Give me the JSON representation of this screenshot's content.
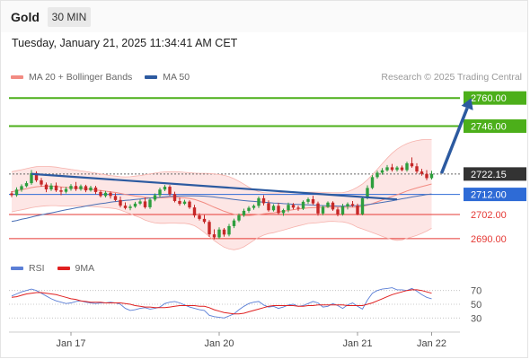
{
  "header": {
    "title": "Gold",
    "timeframe": "30 MIN"
  },
  "datetime": "Tuesday, January 21, 2025 11:34:41 AM CET",
  "credit": "Research © 2025 Trading Central",
  "legend_main": [
    {
      "label": "MA 20 + Bollinger Bands",
      "color": "#f28b82"
    },
    {
      "label": "MA 50",
      "color": "#2c5aa0"
    }
  ],
  "legend_rsi": [
    {
      "label": "RSI",
      "color": "#5b7fd6"
    },
    {
      "label": "9MA",
      "color": "#e02020"
    }
  ],
  "chart_data": [
    {
      "type": "candlestick",
      "ylim": [
        2685,
        2765
      ],
      "x_ticks": [
        {
          "label": "Jan 17",
          "i": 12
        },
        {
          "label": "Jan 20",
          "i": 42
        },
        {
          "label": "Jan 21",
          "i": 70
        },
        {
          "label": "Jan 22",
          "i": 85
        }
      ],
      "levels": [
        {
          "value": 2760.0,
          "label": "2760.00",
          "kind": "resistance",
          "color": "#4caf1a"
        },
        {
          "value": 2746.0,
          "label": "2746.00",
          "kind": "resistance",
          "color": "#4caf1a"
        },
        {
          "value": 2722.15,
          "label": "2722.15",
          "kind": "last",
          "color": "#333333"
        },
        {
          "value": 2712.0,
          "label": "2712.00",
          "kind": "pivot",
          "color": "#2e6bd6"
        },
        {
          "value": 2702.0,
          "label": "2702.00",
          "kind": "support",
          "color": "#e53935"
        },
        {
          "value": 2690.0,
          "label": "2690.00",
          "kind": "support",
          "color": "#e53935"
        }
      ],
      "candles": [
        [
          2712.5,
          2713.6,
          2710.6,
          2711.6
        ],
        [
          2711.6,
          2715.5,
          2710.8,
          2714.4
        ],
        [
          2714.4,
          2717.0,
          2713.3,
          2716.1
        ],
        [
          2716.1,
          2718.6,
          2715.5,
          2717.6
        ],
        [
          2717.6,
          2724.1,
          2716.8,
          2722.6
        ],
        [
          2722.6,
          2723.5,
          2718.2,
          2719.0
        ],
        [
          2719.0,
          2720.2,
          2715.9,
          2716.9
        ],
        [
          2716.9,
          2717.9,
          2713.1,
          2714.5
        ],
        [
          2714.5,
          2717.5,
          2713.7,
          2716.4
        ],
        [
          2716.4,
          2717.9,
          2713.2,
          2714.0
        ],
        [
          2714.0,
          2715.7,
          2711.6,
          2713.3
        ],
        [
          2713.3,
          2715.8,
          2712.5,
          2714.7
        ],
        [
          2714.7,
          2717.1,
          2713.8,
          2716.2
        ],
        [
          2716.2,
          2718.2,
          2713.7,
          2714.6
        ],
        [
          2714.6,
          2716.9,
          2713.8,
          2716.1
        ],
        [
          2716.1,
          2716.8,
          2713.1,
          2714.0
        ],
        [
          2714.0,
          2716.3,
          2713.4,
          2715.4
        ],
        [
          2715.4,
          2716.3,
          2712.1,
          2713.2
        ],
        [
          2713.2,
          2714.1,
          2710.5,
          2711.2
        ],
        [
          2711.2,
          2713.7,
          2710.5,
          2712.8
        ],
        [
          2712.8,
          2713.5,
          2709.9,
          2711.2
        ],
        [
          2711.2,
          2712.6,
          2708.6,
          2709.2
        ],
        [
          2709.2,
          2710.9,
          2705.5,
          2706.4
        ],
        [
          2706.4,
          2708.0,
          2704.5,
          2705.2
        ],
        [
          2705.2,
          2707.0,
          2704.1,
          2705.9
        ],
        [
          2705.9,
          2708.3,
          2705.3,
          2707.4
        ],
        [
          2707.4,
          2709.5,
          2706.7,
          2708.5
        ],
        [
          2708.5,
          2710.5,
          2704.9,
          2705.6
        ],
        [
          2705.6,
          2710.3,
          2704.8,
          2709.4
        ],
        [
          2709.4,
          2712.5,
          2708.6,
          2711.6
        ],
        [
          2711.6,
          2715.4,
          2710.5,
          2714.4
        ],
        [
          2714.4,
          2716.7,
          2713.6,
          2715.8
        ],
        [
          2715.8,
          2716.6,
          2711.3,
          2712.1
        ],
        [
          2712.1,
          2713.3,
          2708.0,
          2708.7
        ],
        [
          2708.7,
          2710.5,
          2706.4,
          2707.3
        ],
        [
          2707.3,
          2709.3,
          2706.7,
          2708.4
        ],
        [
          2708.4,
          2709.1,
          2704.8,
          2705.5
        ],
        [
          2705.5,
          2706.8,
          2700.5,
          2701.5
        ],
        [
          2701.5,
          2702.6,
          2699.0,
          2699.8
        ],
        [
          2699.8,
          2701.7,
          2697.4,
          2698.3
        ],
        [
          2698.3,
          2699.2,
          2690.8,
          2692.1
        ],
        [
          2692.1,
          2694.6,
          2689.6,
          2690.6
        ],
        [
          2690.6,
          2695.6,
          2689.9,
          2694.5
        ],
        [
          2694.5,
          2695.3,
          2690.9,
          2692.0
        ],
        [
          2692.0,
          2697.3,
          2691.1,
          2696.2
        ],
        [
          2696.2,
          2699.9,
          2695.2,
          2699.0
        ],
        [
          2699.0,
          2702.5,
          2698.2,
          2701.6
        ],
        [
          2701.6,
          2704.9,
          2700.8,
          2703.8
        ],
        [
          2703.8,
          2706.2,
          2702.8,
          2705.3
        ],
        [
          2705.3,
          2707.0,
          2704.4,
          2706.3
        ],
        [
          2706.3,
          2711.0,
          2705.2,
          2710.1
        ],
        [
          2710.1,
          2711.6,
          2706.5,
          2707.6
        ],
        [
          2707.6,
          2709.0,
          2703.4,
          2704.1
        ],
        [
          2704.1,
          2707.1,
          2703.5,
          2706.3
        ],
        [
          2706.3,
          2707.8,
          2702.0,
          2702.7
        ],
        [
          2702.7,
          2704.9,
          2701.3,
          2704.2
        ],
        [
          2704.2,
          2707.9,
          2703.1,
          2706.8
        ],
        [
          2706.8,
          2707.7,
          2704.5,
          2705.4
        ],
        [
          2705.4,
          2706.4,
          2703.8,
          2704.9
        ],
        [
          2704.9,
          2709.0,
          2704.2,
          2708.3
        ],
        [
          2708.3,
          2710.4,
          2707.3,
          2709.6
        ],
        [
          2709.6,
          2711.3,
          2706.7,
          2707.5
        ],
        [
          2707.5,
          2708.4,
          2701.4,
          2702.5
        ],
        [
          2702.5,
          2706.5,
          2701.6,
          2705.8
        ],
        [
          2705.8,
          2708.5,
          2705.2,
          2707.9
        ],
        [
          2707.9,
          2708.6,
          2703.8,
          2704.5
        ],
        [
          2704.5,
          2705.5,
          2701.1,
          2702.1
        ],
        [
          2702.1,
          2707.3,
          2701.4,
          2706.0
        ],
        [
          2706.0,
          2708.0,
          2704.5,
          2707.2
        ],
        [
          2707.2,
          2708.7,
          2705.8,
          2706.4
        ],
        [
          2706.4,
          2707.4,
          2701.6,
          2702.2
        ],
        [
          2702.2,
          2711.1,
          2701.6,
          2710.1
        ],
        [
          2710.1,
          2716.5,
          2709.5,
          2715.2
        ],
        [
          2715.2,
          2721.6,
          2714.6,
          2720.6
        ],
        [
          2720.6,
          2723.8,
          2719.8,
          2722.8
        ],
        [
          2722.8,
          2725.1,
          2721.8,
          2724.0
        ],
        [
          2724.0,
          2726.6,
          2723.3,
          2725.5
        ],
        [
          2725.5,
          2727.2,
          2723.4,
          2724.2
        ],
        [
          2724.2,
          2726.2,
          2723.4,
          2725.4
        ],
        [
          2725.4,
          2726.4,
          2723.5,
          2724.1
        ],
        [
          2724.1,
          2728.3,
          2723.3,
          2727.5
        ],
        [
          2727.5,
          2730.4,
          2725.3,
          2726.0
        ],
        [
          2726.0,
          2727.5,
          2722.4,
          2723.4
        ],
        [
          2723.4,
          2724.7,
          2721.3,
          2722.2
        ],
        [
          2722.2,
          2724.1,
          2719.1,
          2720.1
        ],
        [
          2720.1,
          2723.7,
          2719.4,
          2722.2
        ]
      ],
      "ma20": [
        2713.3,
        2713.8,
        2714.3,
        2714.8,
        2715.4,
        2715.8,
        2716.0,
        2716.1,
        2716.1,
        2716.0,
        2715.7,
        2715.5,
        2715.3,
        2715.2,
        2715.0,
        2714.8,
        2714.5,
        2714.2,
        2713.9,
        2713.6,
        2713.3,
        2713.0,
        2712.5,
        2712.0,
        2711.6,
        2711.2,
        2710.9,
        2710.5,
        2710.3,
        2710.2,
        2710.3,
        2710.4,
        2710.5,
        2710.5,
        2710.4,
        2710.3,
        2710.0,
        2709.5,
        2708.7,
        2707.8,
        2706.7,
        2705.6,
        2704.6,
        2703.6,
        2702.8,
        2702.1,
        2701.7,
        2701.5,
        2701.5,
        2701.7,
        2702.0,
        2702.3,
        2702.6,
        2702.8,
        2703.2,
        2703.6,
        2704.0,
        2704.4,
        2704.7,
        2705.0,
        2705.3,
        2705.4,
        2705.5,
        2705.6,
        2705.7,
        2705.7,
        2705.6,
        2705.6,
        2705.6,
        2705.6,
        2705.6,
        2706.0,
        2706.6,
        2707.4,
        2708.3,
        2709.2,
        2710.1,
        2711.0,
        2711.8,
        2712.7,
        2713.7,
        2714.5,
        2715.2,
        2715.9,
        2716.5,
        2717.2
      ],
      "bb_upper": [
        2723.3,
        2723.8,
        2724.3,
        2724.8,
        2725.4,
        2725.8,
        2725.9,
        2725.9,
        2725.8,
        2725.6,
        2725.2,
        2724.8,
        2724.4,
        2724.1,
        2723.7,
        2723.4,
        2723.0,
        2722.6,
        2722.2,
        2721.8,
        2721.4,
        2721.1,
        2720.8,
        2720.7,
        2720.8,
        2721.1,
        2721.4,
        2721.8,
        2722.2,
        2722.6,
        2723.0,
        2723.2,
        2723.3,
        2723.3,
        2723.2,
        2723.0,
        2722.8,
        2722.6,
        2722.5,
        2722.5,
        2722.4,
        2722.2,
        2721.9,
        2721.5,
        2720.8,
        2719.8,
        2718.5,
        2717.1,
        2715.6,
        2714.3,
        2713.4,
        2712.9,
        2712.7,
        2712.7,
        2712.8,
        2713.0,
        2713.1,
        2713.1,
        2713.1,
        2713.1,
        2713.1,
        2713.1,
        2713.1,
        2713.0,
        2712.9,
        2712.8,
        2712.8,
        2712.9,
        2713.4,
        2714.3,
        2715.6,
        2717.2,
        2719.3,
        2721.8,
        2724.5,
        2727.3,
        2730.0,
        2732.5,
        2734.5,
        2736.1,
        2737.3,
        2738.2,
        2738.8,
        2739.2,
        2739.3,
        2739.3
      ],
      "bb_lower": [
        2703.3,
        2703.8,
        2704.3,
        2704.8,
        2705.4,
        2705.8,
        2706.1,
        2706.3,
        2706.4,
        2706.4,
        2706.2,
        2706.2,
        2706.2,
        2706.3,
        2706.3,
        2706.2,
        2706.0,
        2705.8,
        2705.6,
        2705.4,
        2705.2,
        2704.9,
        2704.2,
        2703.3,
        2702.4,
        2701.3,
        2700.4,
        2699.2,
        2698.4,
        2697.8,
        2697.6,
        2697.6,
        2697.7,
        2697.7,
        2697.6,
        2697.6,
        2697.2,
        2696.4,
        2694.9,
        2693.1,
        2691.0,
        2689.0,
        2687.3,
        2685.7,
        2684.8,
        2684.4,
        2684.9,
        2685.9,
        2687.4,
        2689.1,
        2690.6,
        2691.7,
        2692.5,
        2692.9,
        2693.6,
        2694.2,
        2694.9,
        2695.7,
        2696.3,
        2696.9,
        2697.5,
        2697.7,
        2697.9,
        2698.2,
        2698.5,
        2698.6,
        2698.4,
        2698.3,
        2697.8,
        2696.9,
        2695.6,
        2694.8,
        2693.9,
        2693.0,
        2692.1,
        2691.1,
        2690.2,
        2689.5,
        2689.1,
        2689.3,
        2690.1,
        2690.8,
        2691.6,
        2692.6,
        2693.7,
        2695.1
      ],
      "ma50": [
        2698.5,
        2699.0,
        2699.6,
        2700.1,
        2700.7,
        2701.3,
        2701.8,
        2702.3,
        2702.8,
        2703.3,
        2703.8,
        2704.3,
        2704.8,
        2705.3,
        2705.7,
        2706.2,
        2706.6,
        2707.0,
        2707.4,
        2707.7,
        2708.1,
        2708.4,
        2708.7,
        2709.0,
        2709.2,
        2709.5,
        2709.7,
        2710.0,
        2710.2,
        2710.4,
        2710.6,
        2710.8,
        2711.0,
        2711.1,
        2711.2,
        2711.3,
        2711.3,
        2711.3,
        2711.2,
        2711.1,
        2710.9,
        2710.7,
        2710.4,
        2710.1,
        2709.8,
        2709.5,
        2709.2,
        2708.9,
        2708.7,
        2708.5,
        2708.3,
        2708.1,
        2707.9,
        2707.7,
        2707.6,
        2707.4,
        2707.3,
        2707.1,
        2707.0,
        2706.9,
        2706.8,
        2706.7,
        2706.5,
        2706.4,
        2706.3,
        2706.3,
        2706.2,
        2706.2,
        2706.2,
        2706.3,
        2706.4,
        2706.6,
        2706.9,
        2707.2,
        2707.6,
        2708.0,
        2708.4,
        2708.8,
        2709.3,
        2709.8,
        2710.2,
        2710.7,
        2711.1,
        2711.5,
        2711.9,
        2712.2
      ],
      "trendline": {
        "from": [
          4,
          2722.2
        ],
        "to": [
          78,
          2709.5
        ]
      },
      "projection": {
        "from": [
          87,
          2722.5
        ],
        "to": [
          93,
          2760.0
        ]
      }
    },
    {
      "type": "line",
      "title": "RSI",
      "ylim": [
        20,
        80
      ],
      "y_ticks": [
        70,
        50,
        30
      ],
      "rsi": [
        62,
        65,
        68,
        70,
        72,
        70,
        66,
        62,
        58,
        55,
        53,
        51,
        52,
        54,
        55,
        53,
        52,
        51,
        52,
        52,
        53,
        52,
        50,
        44,
        41,
        42,
        44,
        45,
        43,
        44,
        46,
        51,
        53,
        54,
        52,
        49,
        46,
        44,
        42,
        41,
        34,
        32,
        31,
        30,
        33,
        36,
        42,
        47,
        51,
        53,
        54,
        49,
        46,
        47,
        44,
        46,
        49,
        50,
        47,
        48,
        51,
        54,
        52,
        46,
        47,
        51,
        48,
        44,
        49,
        52,
        47,
        43,
        56,
        66,
        70,
        72,
        73,
        74,
        71,
        71,
        70,
        73,
        69,
        64,
        60,
        58
      ],
      "ma9": [
        60,
        61,
        63,
        65,
        66,
        67,
        67,
        66,
        65,
        64,
        62,
        60,
        58,
        57,
        55,
        54,
        53,
        53,
        53,
        52,
        52,
        52,
        52,
        51,
        50,
        48,
        47,
        46,
        46,
        45,
        45,
        45,
        46,
        47,
        48,
        48,
        48,
        48,
        47,
        47,
        45,
        42,
        40,
        38,
        37,
        36,
        36,
        37,
        39,
        41,
        43,
        45,
        47,
        48,
        48,
        48,
        48,
        48,
        47,
        47,
        48,
        48,
        49,
        49,
        49,
        49,
        49,
        49,
        48,
        48,
        48,
        48,
        50,
        52,
        55,
        58,
        61,
        64,
        66,
        68,
        70,
        71,
        71,
        70,
        68,
        66
      ]
    }
  ]
}
